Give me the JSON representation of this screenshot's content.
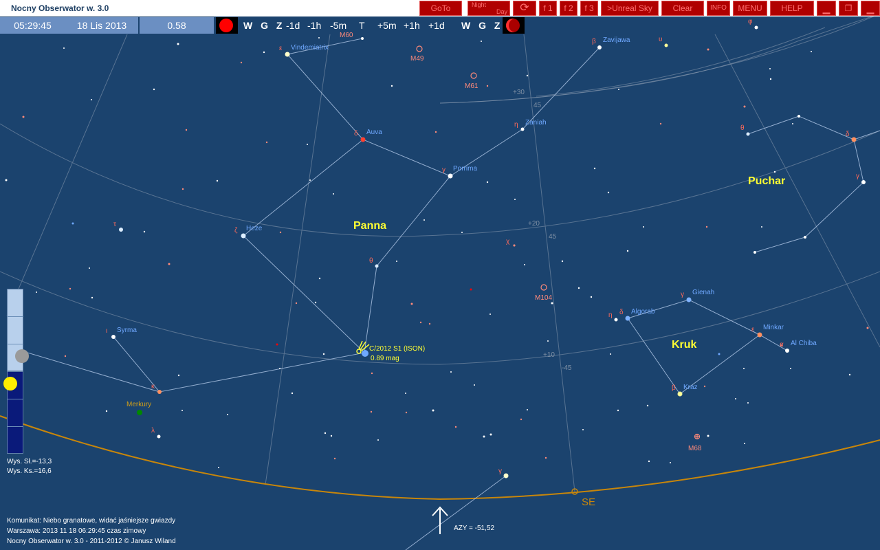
{
  "window": {
    "title": "Nocny Obserwator w. 3.0"
  },
  "toolbar": {
    "goto": "GoTo",
    "night": "Night",
    "day": "Day",
    "f1": "f 1",
    "f2": "f 2",
    "f3": "f 3",
    "unreal_sky": ">Unreal Sky",
    "clear": "Clear",
    "info": "INFO",
    "menu": "MENU",
    "help": "HELP"
  },
  "infobar": {
    "time": "05:29:45",
    "date": "18 Lis 2013",
    "value": "0.58"
  },
  "time_controls": {
    "left_keys": "W G Z",
    "minus_1d": "-1d",
    "minus_1h": "-1h",
    "minus_5m": "-5m",
    "now": "T",
    "plus_5m": "+5m",
    "plus_1h": "+1h",
    "plus_1d": "+1d",
    "right_keys": "W G Z"
  },
  "constellations": {
    "panna": "Panna",
    "kruk": "Kruk",
    "puchar": "Puchar"
  },
  "stars": {
    "vindemiatrix": "Vindemiatrix",
    "vindemiatrix_greek": "ε",
    "auva": "Auva",
    "auva_greek": "δ",
    "porrima": "Porrima",
    "porrima_greek": "γ",
    "zaniah": "Zaniah",
    "zaniah_greek": "η",
    "zavijawa": "Zavijawa",
    "zavijawa_greek": "β",
    "heze": "Heze",
    "heze_greek": "ζ",
    "theta_vir": "θ",
    "tau_vir": "τ",
    "chi_vir": "χ",
    "syrma": "Syrma",
    "syrma_greek": "ι",
    "kappa_vir": "κ",
    "lambda_vir": "λ",
    "upsilon": "υ",
    "phi": "φ",
    "gienah": "Gienah",
    "gienah_greek": "γ",
    "algorab": "Algorab",
    "algorab_greek": "δ",
    "eta_crv": "η",
    "minkar": "Minkar",
    "minkar_greek": "ε",
    "al_chiba": "Al Chiba",
    "al_chiba_greek": "α",
    "kraz": "Kraz",
    "kraz_greek": "β",
    "theta_crt": "θ",
    "delta_crt": "δ",
    "gamma_crt": "γ",
    "gamma_lower": "γ"
  },
  "deep_sky": {
    "m49": "M49",
    "m61": "M61",
    "m104": "M104",
    "m68": "M68",
    "m60": "M60"
  },
  "comet": {
    "name": "C/2012 S1 (ISON)",
    "magnitude": "0.89 mag"
  },
  "planets": {
    "merkury": "Merkury"
  },
  "grid_labels": {
    "dec_plus30": "+30",
    "dec_plus20": "+20",
    "dec_plus10": "+10",
    "ra45_a": "45",
    "ra45_b": "45",
    "ra45_c": "-45"
  },
  "horizon": {
    "direction": "SE",
    "azimuth": "AZY = -51,52"
  },
  "altitude_gauge": {
    "sun_altitude": "Wys. Sł.=-13,3",
    "moon_altitude": "Wys. Ks.=16,6"
  },
  "status": {
    "message": "Komunikat: Niebo granatowe, widać jaśniejsze gwiazdy",
    "location_time": "Warszawa:  2013 11 18  06:29:45 czas zimowy",
    "copyright": "Nocny Obserwator w. 3.0 - 2011-2012 © Janusz Wiland"
  },
  "colors": {
    "sky": "#1b436e",
    "grid": "#8899aa",
    "horizon": "#c8860a",
    "label_blue": "#6fa8ff",
    "greek_red": "#ff6a5a",
    "constellation_name": "#ffff33",
    "button_red": "#b00000"
  }
}
